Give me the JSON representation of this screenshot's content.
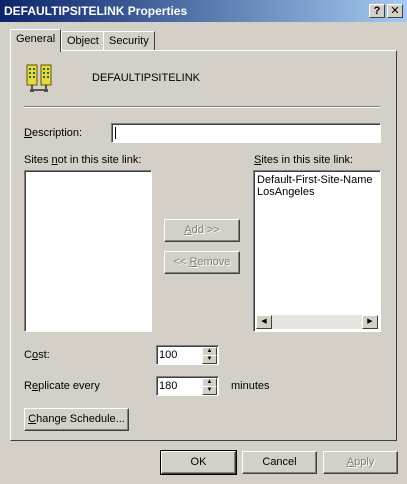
{
  "window": {
    "title": "DEFAULTIPSITELINK Properties",
    "help_glyph": "?",
    "close_glyph": "✕"
  },
  "tabs": [
    {
      "label": "General",
      "active": true
    },
    {
      "label": "Object",
      "active": false
    },
    {
      "label": "Security",
      "active": false
    }
  ],
  "header": {
    "icon": "site-link-icon",
    "name": "DEFAULTIPSITELINK"
  },
  "description": {
    "label_accel": "D",
    "label_rest": "escription:",
    "value": ""
  },
  "sites_not_in": {
    "label_pre": "Sites ",
    "label_accel": "n",
    "label_rest": "ot in this site link:",
    "items": []
  },
  "sites_in": {
    "label_accel": "S",
    "label_rest": "ites in this site link:",
    "items": [
      "Default-First-Site-Name",
      "LosAngeles"
    ]
  },
  "buttons": {
    "add_accel": "A",
    "add_rest": "dd >>",
    "remove_pre": "<< ",
    "remove_accel": "R",
    "remove_rest": "emove",
    "change_schedule_accel": "C",
    "change_schedule_rest": "hange Schedule...",
    "ok": "OK",
    "cancel": "Cancel",
    "apply_accel": "A",
    "apply_rest": "pply"
  },
  "cost": {
    "label_pre": "C",
    "label_accel": "o",
    "label_rest": "st:",
    "value": "100"
  },
  "replicate": {
    "label_pre": "R",
    "label_accel": "e",
    "label_rest": "plicate every",
    "value": "180",
    "unit": "minutes"
  }
}
